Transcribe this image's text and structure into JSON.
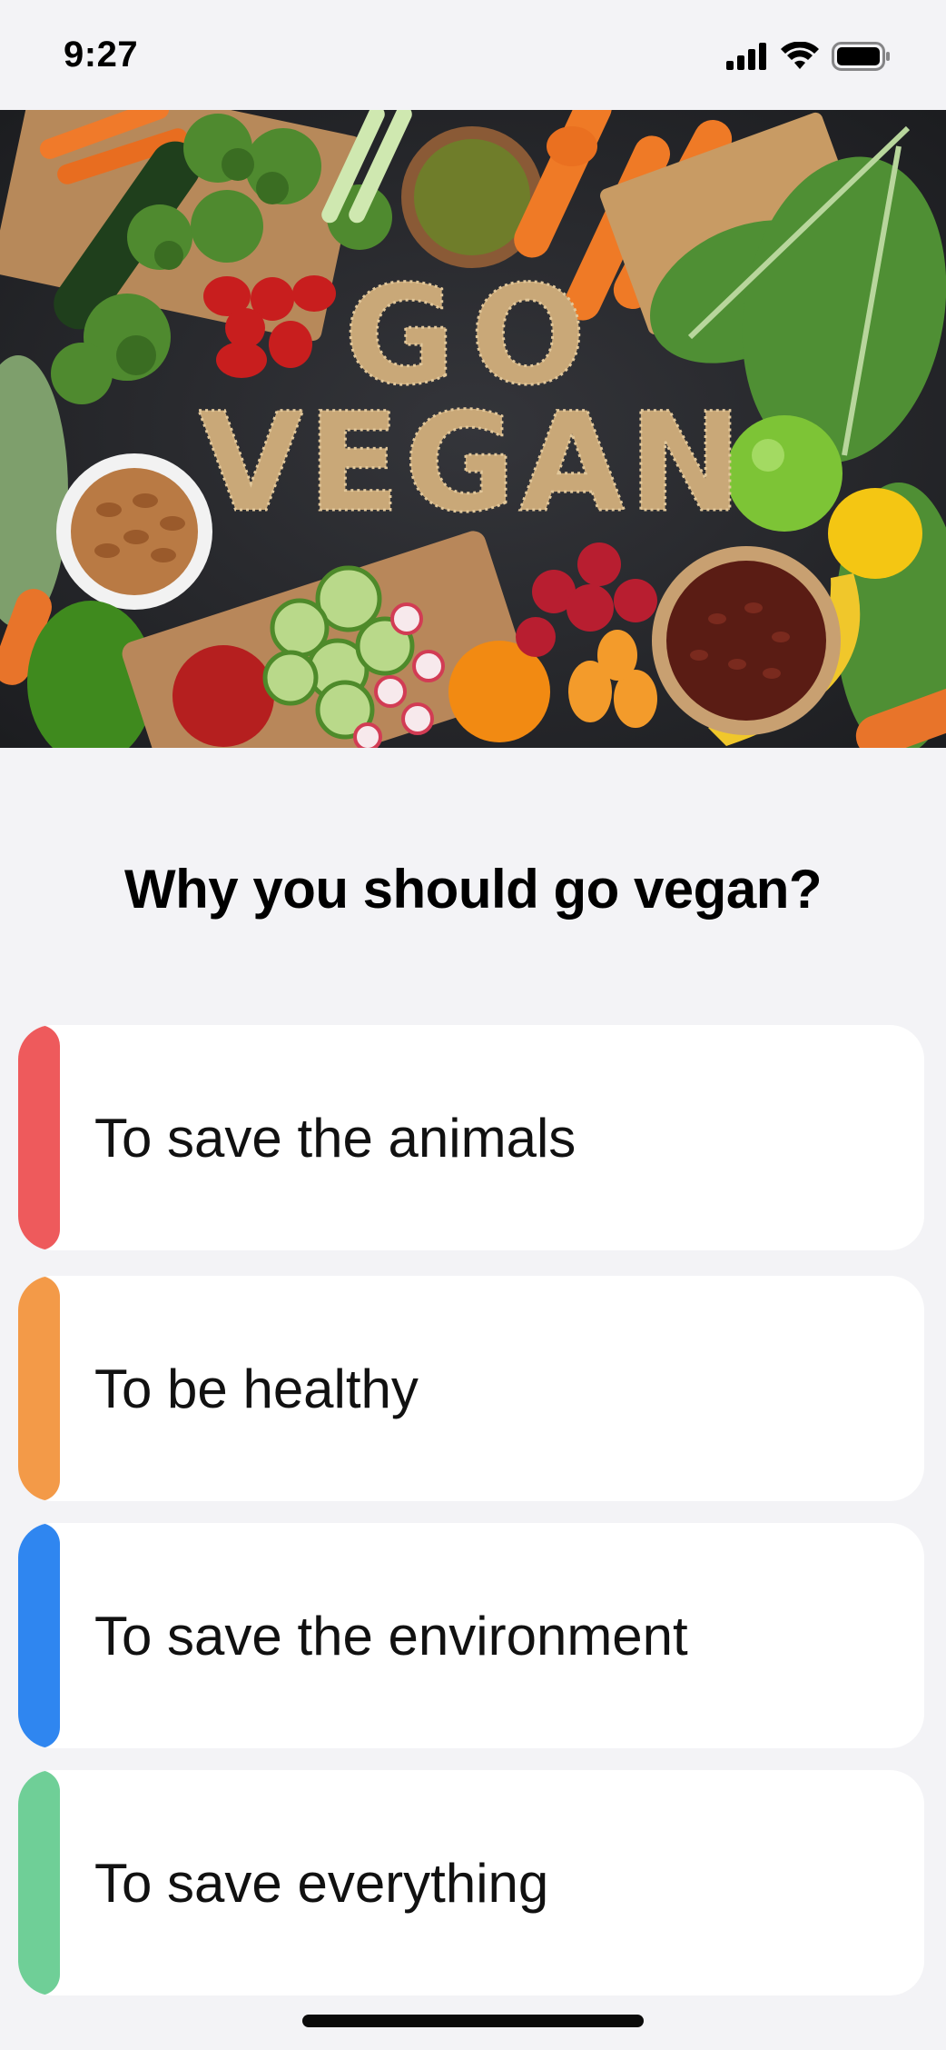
{
  "status_bar": {
    "time": "9:27",
    "icons": [
      "cellular-signal-icon",
      "wifi-icon",
      "battery-icon"
    ]
  },
  "hero_image": {
    "text": "GO VEGAN"
  },
  "quiz": {
    "question": "Why you should go vegan?",
    "options": [
      {
        "label": "To save the animals",
        "color": "#ee5a5c"
      },
      {
        "label": "To be healthy",
        "color": "#f39a48"
      },
      {
        "label": "To save the environment",
        "color": "#2f86f0"
      },
      {
        "label": "To save everything",
        "color": "#6fcf97"
      }
    ]
  }
}
